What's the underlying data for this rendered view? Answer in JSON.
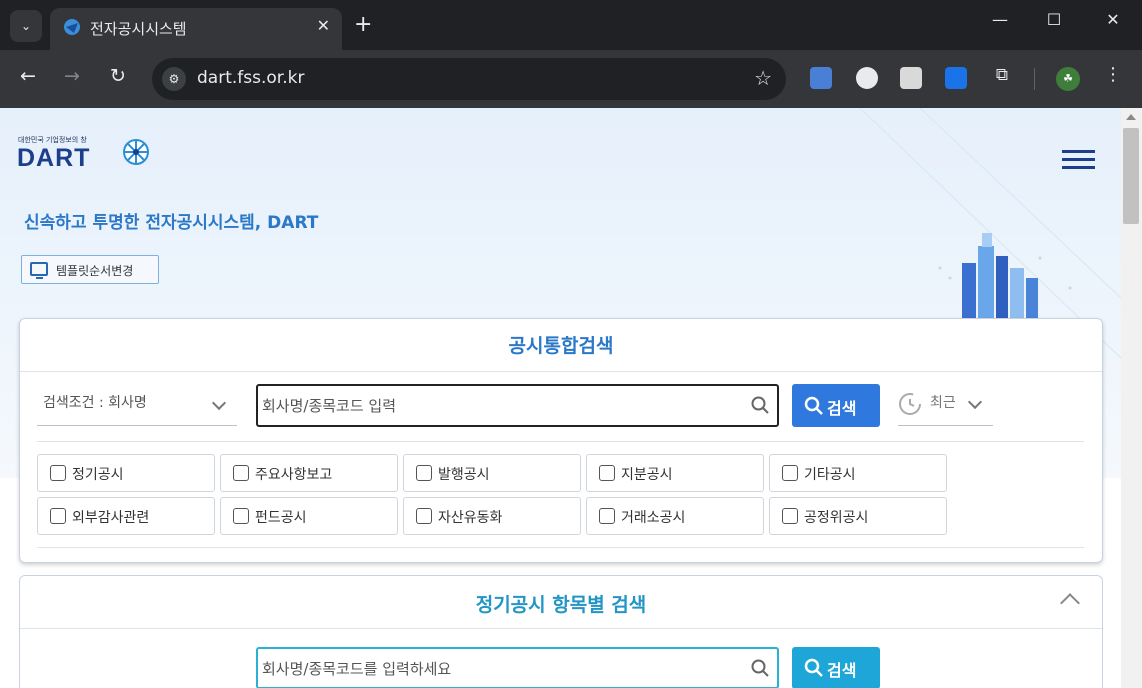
{
  "browser": {
    "tab_title": "전자공시시스템",
    "url": "dart.fss.or.kr"
  },
  "header": {
    "logo_tagline": "대한민국 기업정보의 창",
    "logo_text": "DART",
    "slogan": "신속하고 투명한 전자공시시스템, DART",
    "template_button": "템플릿순서변경"
  },
  "integrated_search": {
    "title": "공시통합검색",
    "condition": "검색조건 : 회사명",
    "input_placeholder": "회사명/종목코드 입력",
    "search_button": "검색",
    "recent": "최근",
    "filters": [
      "정기공시",
      "주요사항보고",
      "발행공시",
      "지분공시",
      "기타공시",
      "외부감사관련",
      "펀드공시",
      "자산유동화",
      "거래소공시",
      "공정위공시"
    ]
  },
  "periodic_search": {
    "title": "정기공시 항목별 검색",
    "input_placeholder": "회사명/종목코드를 입력하세요",
    "search_button": "검색"
  },
  "colors": {
    "brand_blue": "#1c3f8c",
    "accent_blue": "#2f79de",
    "accent_cyan": "#1fa6d8"
  }
}
